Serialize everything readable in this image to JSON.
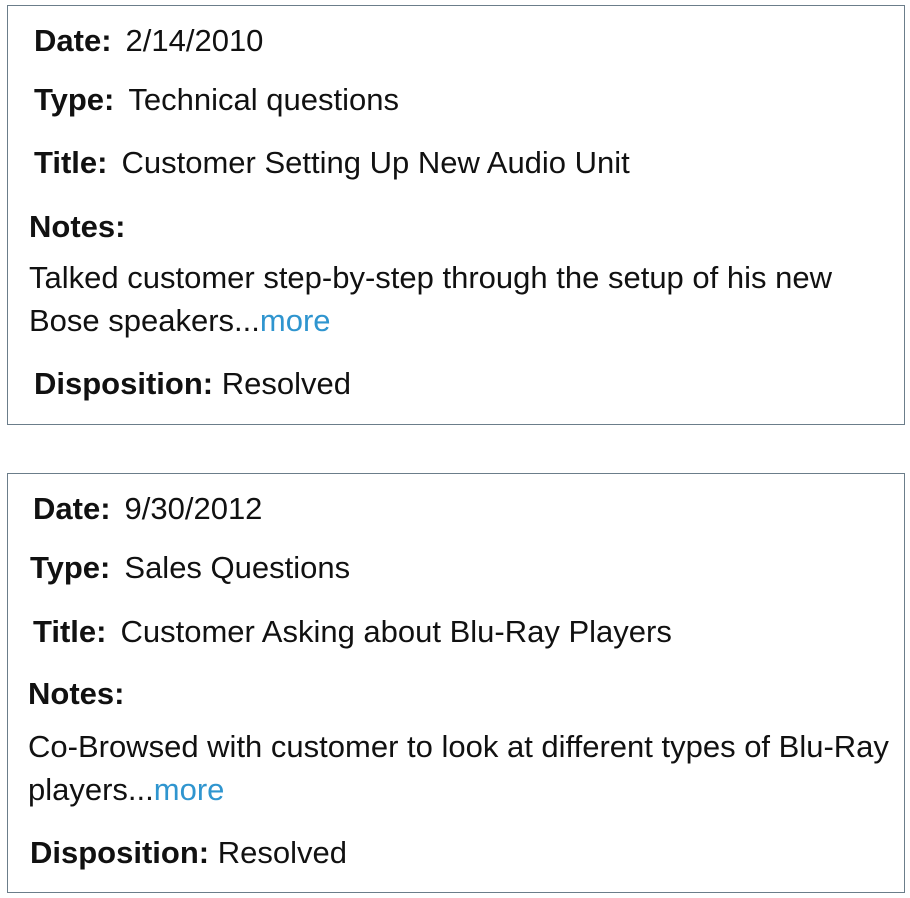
{
  "labels": {
    "date": "Date:",
    "type": "Type:",
    "title": "Title:",
    "notes": "Notes:",
    "disposition": "Disposition:",
    "more": "more"
  },
  "cases": [
    {
      "date": "2/14/2010",
      "type": "Technical questions",
      "title": "Customer Setting Up New Audio Unit",
      "notes": "Talked customer step-by-step through the setup of his new Bose speakers...",
      "disposition": "Resolved"
    },
    {
      "date": "9/30/2012",
      "type": "Sales Questions",
      "title": "Customer Asking about Blu-Ray Players",
      "notes": "Co-Browsed with customer to look at different types of Blu-Ray players...",
      "disposition": "Resolved"
    }
  ],
  "colors": {
    "link": "#2f95cf",
    "border": "#6b7d8a"
  }
}
